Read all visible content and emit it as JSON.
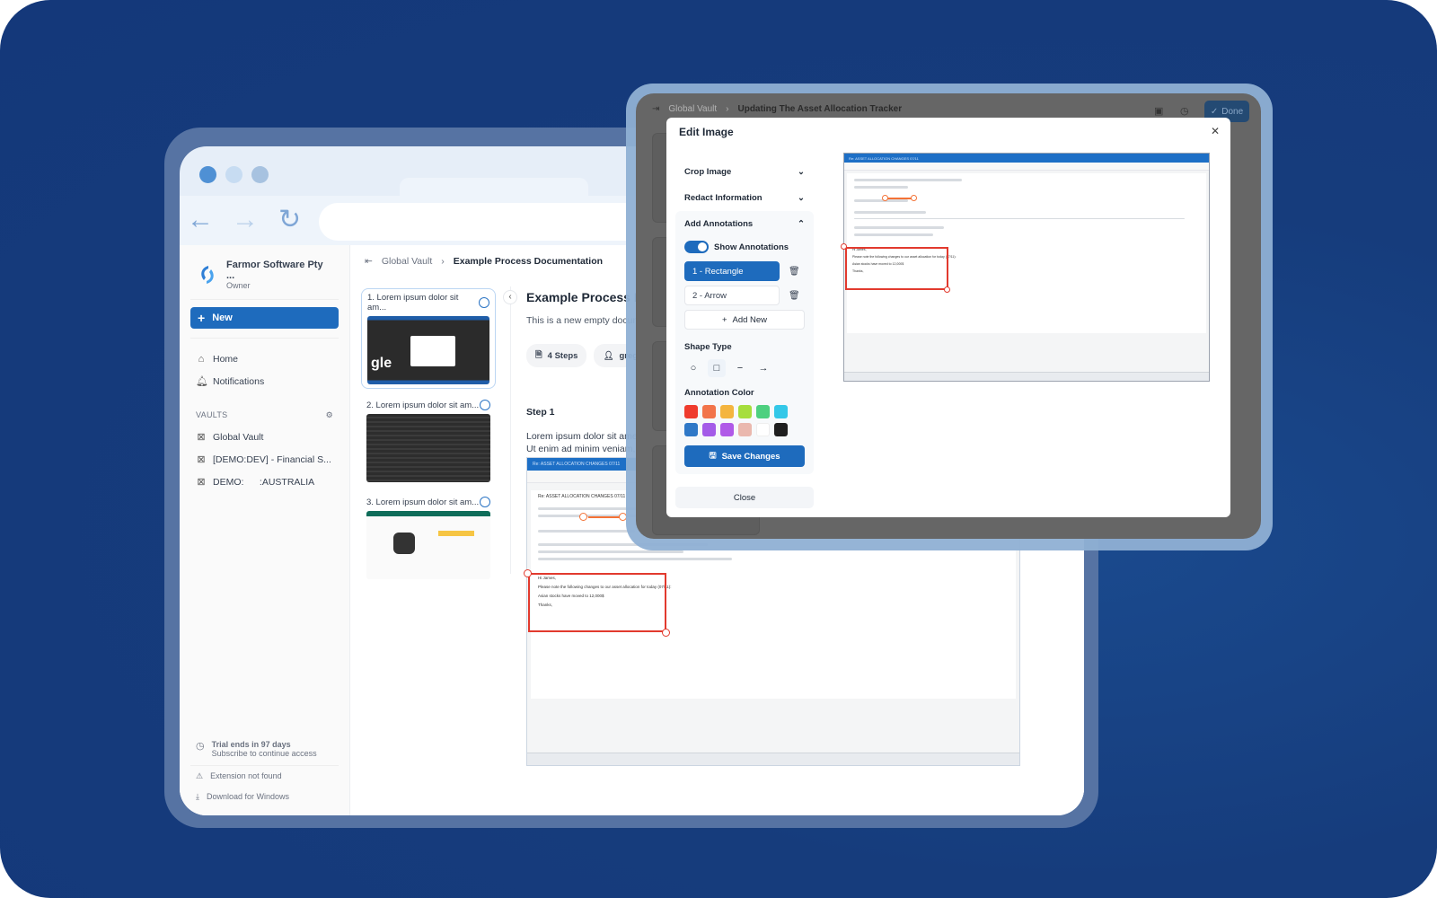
{
  "browser": {
    "nav": {
      "back_icon": "arrow-left-icon",
      "forward_icon": "arrow-right-icon",
      "reload_icon": "reload-icon"
    },
    "traffic_colors": [
      "#4f90d4",
      "#c7dcf2",
      "#a7c2e0"
    ]
  },
  "sidebar": {
    "org_name": "Farmor Software Pty ...",
    "org_role": "Owner",
    "new_label": "New",
    "nav": [
      {
        "icon": "home-icon",
        "label": "Home"
      },
      {
        "icon": "bell-icon",
        "label": "Notifications"
      }
    ],
    "vaults_header": "VAULTS",
    "vaults": [
      {
        "label": "Global Vault"
      },
      {
        "label": "[DEMO:DEV] - Financial S..."
      },
      {
        "label": "DEMO:      :AUSTRALIA"
      }
    ],
    "trial_title": "Trial ends in 97 days",
    "trial_sub": "Subscribe to continue access",
    "extension": "Extension not found",
    "download": "Download for Windows"
  },
  "main": {
    "breadcrumb": {
      "parent": "Global Vault",
      "current": "Example Process Documentation"
    },
    "steps": [
      {
        "label": "1. Lorem ipsum dolor sit am..."
      },
      {
        "label": "2. Lorem ipsum dolor sit am..."
      },
      {
        "label": "3. Lorem ipsum dolor sit am..."
      }
    ],
    "doc_title": "Example Process Doc",
    "doc_desc": "This is a new empty docum",
    "chips": {
      "steps": "4 Steps",
      "author": "greg g"
    },
    "step_title": "Step 1",
    "step_text_1": "Lorem ipsum dolor sit amet",
    "step_text_2": "Ut enim ad minim veniam, c",
    "screenshot": {
      "subject": "Re: ASSET ALLOCATION CHANGES 07/11",
      "greeting": "Hi James,",
      "line1": "Please note the following changes to our asset allocation for today (07/11):",
      "line2": "Asian stocks have moved to 12,000$",
      "thanks": "Thanks,"
    }
  },
  "editor_window": {
    "breadcrumb": {
      "parent": "Global Vault",
      "current": "Updating The Asset Allocation Tracker"
    },
    "done_label": "Done"
  },
  "dialog": {
    "title": "Edit Image",
    "crop": "Crop Image",
    "redact": "Redact Information",
    "annotations": "Add Annotations",
    "show_annotations": "Show Annotations",
    "show_annotations_on": true,
    "items": [
      {
        "label": "1 - Rectangle",
        "selected": true
      },
      {
        "label": "2 - Arrow",
        "selected": false
      }
    ],
    "add_new": "Add New",
    "shape_type": "Shape Type",
    "shapes": [
      {
        "name": "circle-shape",
        "glyph": "○"
      },
      {
        "name": "rectangle-shape",
        "glyph": "□",
        "selected": true
      },
      {
        "name": "line-shape",
        "glyph": "−"
      },
      {
        "name": "arrow-shape",
        "glyph": "→"
      }
    ],
    "color_label": "Annotation Color",
    "colors": [
      "#ef3b2d",
      "#f2744a",
      "#f4b53f",
      "#a6de3c",
      "#4dd07f",
      "#34c8e8",
      "#2f78c7",
      "#a45be8",
      "#b05ae8",
      "#eab8ae",
      "#ffffff",
      "#1f1f1f"
    ],
    "save": "Save Changes",
    "close": "Close"
  }
}
